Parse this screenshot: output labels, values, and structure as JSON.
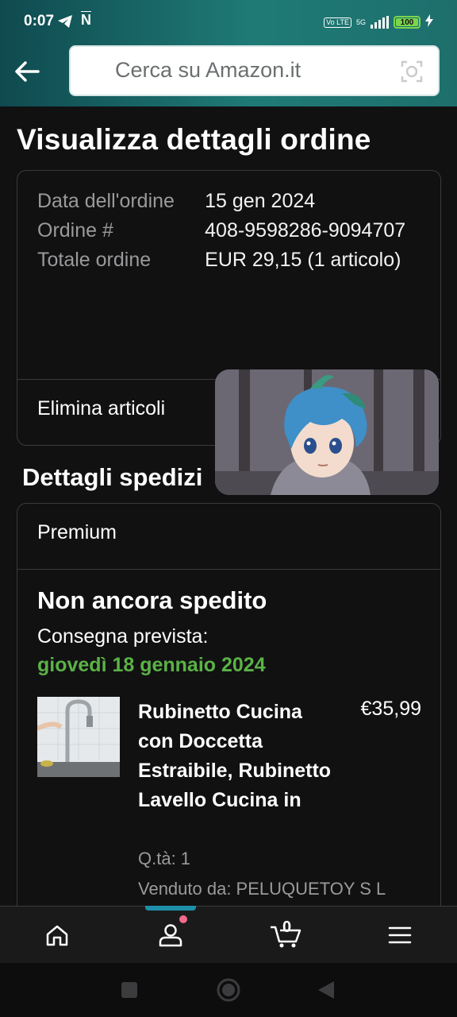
{
  "status_bar": {
    "time": "0:07",
    "volte": "Vo LTE",
    "network": "5G",
    "battery": "100"
  },
  "header": {
    "search_placeholder": "Cerca su Amazon.it"
  },
  "page": {
    "title": "Visualizza dettagli ordine"
  },
  "order": {
    "date_label": "Data dell'ordine",
    "date_value": "15 gen 2024",
    "number_label": "Ordine #",
    "number_value": "408-9598286-9094707",
    "total_label": "Totale ordine",
    "total_value": "EUR 29,15 (1 articolo)",
    "delete_items": "Elimina articoli"
  },
  "shipping": {
    "section_title": "Dettagli spedizi",
    "type": "Premium",
    "status": "Non ancora spedito",
    "delivery_label": "Consegna prevista:",
    "delivery_date": "giovedì 18 gennaio 2024"
  },
  "item": {
    "name": "Rubinetto Cucina con Doccetta Estraibile, Rubinetto Lavello Cucina in",
    "price": "€35,99",
    "quantity": "Q.tà: 1",
    "seller": "Venduto da: PELUQUETOY S L"
  },
  "bottom_nav": {
    "cart_count": "0",
    "items": [
      "home-icon",
      "account-icon",
      "cart-icon",
      "menu-icon"
    ],
    "active_color": "#1e8fa8"
  },
  "colors": {
    "accent_green": "#5bb246",
    "header_gradient": "#1f7a76",
    "notification_dot": "#f06a8a"
  }
}
